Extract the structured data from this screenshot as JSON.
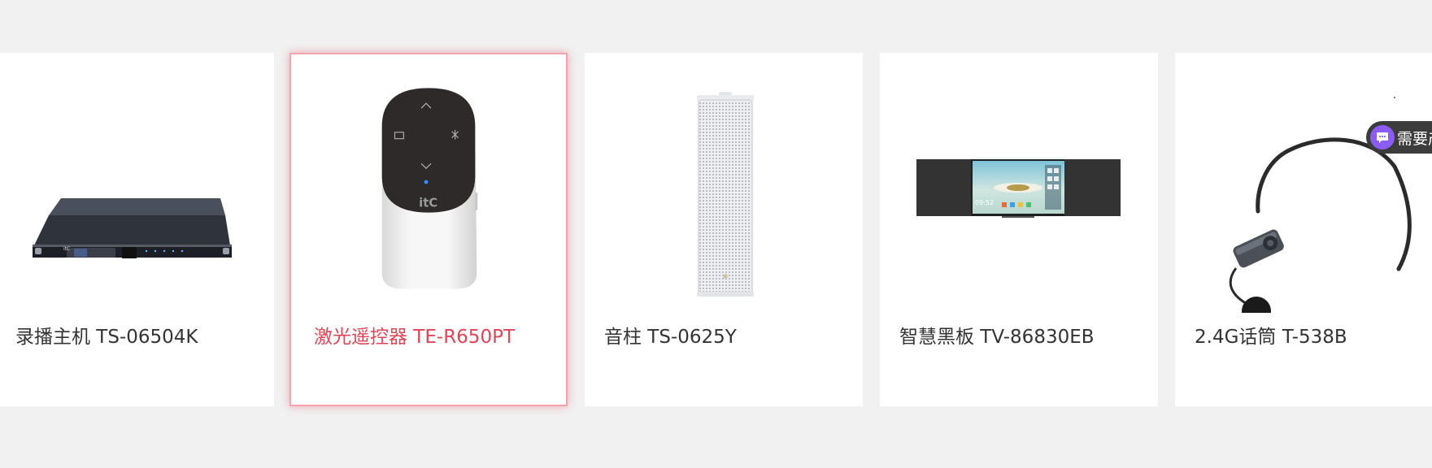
{
  "products": [
    {
      "title": "录播主机 TS-06504K",
      "image": "recording-host-device"
    },
    {
      "title": "激光遥控器 TE-R650PT",
      "image": "laser-remote-control",
      "selected": true
    },
    {
      "title": "音柱 TS-0625Y",
      "image": "column-speaker"
    },
    {
      "title": "智慧黑板 TV-86830EB",
      "image": "smart-blackboard"
    },
    {
      "title": "2.4G话筒 T-538B",
      "image": "headset-microphone"
    }
  ],
  "remote_logo": "itC",
  "blackboard_clock": "09:52",
  "chat": {
    "label": "需要产",
    "icon": "chat-bubble-icon"
  },
  "colors": {
    "accent": "#e04455",
    "chat_purple": "#8b5cf6",
    "page_bg": "#f1f1f1"
  }
}
